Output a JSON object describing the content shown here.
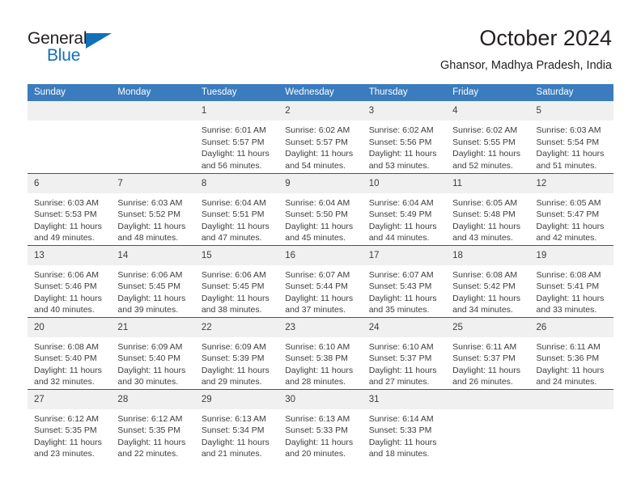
{
  "logo": {
    "word1": "General",
    "word2": "Blue",
    "triangle_icon": "triangle-icon",
    "brand_color": "#1270b8"
  },
  "header": {
    "title": "October 2024",
    "subtitle": "Ghansor, Madhya Pradesh, India"
  },
  "theme": {
    "header_bg": "#3a7cbe",
    "header_text": "#ffffff",
    "row_border": "#1f5c9e",
    "daynum_bg": "#f0f0f0",
    "text": "#3d3d3d"
  },
  "weekday_headers": [
    "Sunday",
    "Monday",
    "Tuesday",
    "Wednesday",
    "Thursday",
    "Friday",
    "Saturday"
  ],
  "weeks": [
    [
      {
        "day": "",
        "empty": true,
        "sunrise": "",
        "sunset": "",
        "daylight1": "",
        "daylight2": ""
      },
      {
        "day": "",
        "empty": true,
        "sunrise": "",
        "sunset": "",
        "daylight1": "",
        "daylight2": ""
      },
      {
        "day": "1",
        "sunrise": "Sunrise: 6:01 AM",
        "sunset": "Sunset: 5:57 PM",
        "daylight1": "Daylight: 11 hours",
        "daylight2": "and 56 minutes."
      },
      {
        "day": "2",
        "sunrise": "Sunrise: 6:02 AM",
        "sunset": "Sunset: 5:57 PM",
        "daylight1": "Daylight: 11 hours",
        "daylight2": "and 54 minutes."
      },
      {
        "day": "3",
        "sunrise": "Sunrise: 6:02 AM",
        "sunset": "Sunset: 5:56 PM",
        "daylight1": "Daylight: 11 hours",
        "daylight2": "and 53 minutes."
      },
      {
        "day": "4",
        "sunrise": "Sunrise: 6:02 AM",
        "sunset": "Sunset: 5:55 PM",
        "daylight1": "Daylight: 11 hours",
        "daylight2": "and 52 minutes."
      },
      {
        "day": "5",
        "sunrise": "Sunrise: 6:03 AM",
        "sunset": "Sunset: 5:54 PM",
        "daylight1": "Daylight: 11 hours",
        "daylight2": "and 51 minutes."
      }
    ],
    [
      {
        "day": "6",
        "sunrise": "Sunrise: 6:03 AM",
        "sunset": "Sunset: 5:53 PM",
        "daylight1": "Daylight: 11 hours",
        "daylight2": "and 49 minutes."
      },
      {
        "day": "7",
        "sunrise": "Sunrise: 6:03 AM",
        "sunset": "Sunset: 5:52 PM",
        "daylight1": "Daylight: 11 hours",
        "daylight2": "and 48 minutes."
      },
      {
        "day": "8",
        "sunrise": "Sunrise: 6:04 AM",
        "sunset": "Sunset: 5:51 PM",
        "daylight1": "Daylight: 11 hours",
        "daylight2": "and 47 minutes."
      },
      {
        "day": "9",
        "sunrise": "Sunrise: 6:04 AM",
        "sunset": "Sunset: 5:50 PM",
        "daylight1": "Daylight: 11 hours",
        "daylight2": "and 45 minutes."
      },
      {
        "day": "10",
        "sunrise": "Sunrise: 6:04 AM",
        "sunset": "Sunset: 5:49 PM",
        "daylight1": "Daylight: 11 hours",
        "daylight2": "and 44 minutes."
      },
      {
        "day": "11",
        "sunrise": "Sunrise: 6:05 AM",
        "sunset": "Sunset: 5:48 PM",
        "daylight1": "Daylight: 11 hours",
        "daylight2": "and 43 minutes."
      },
      {
        "day": "12",
        "sunrise": "Sunrise: 6:05 AM",
        "sunset": "Sunset: 5:47 PM",
        "daylight1": "Daylight: 11 hours",
        "daylight2": "and 42 minutes."
      }
    ],
    [
      {
        "day": "13",
        "sunrise": "Sunrise: 6:06 AM",
        "sunset": "Sunset: 5:46 PM",
        "daylight1": "Daylight: 11 hours",
        "daylight2": "and 40 minutes."
      },
      {
        "day": "14",
        "sunrise": "Sunrise: 6:06 AM",
        "sunset": "Sunset: 5:45 PM",
        "daylight1": "Daylight: 11 hours",
        "daylight2": "and 39 minutes."
      },
      {
        "day": "15",
        "sunrise": "Sunrise: 6:06 AM",
        "sunset": "Sunset: 5:45 PM",
        "daylight1": "Daylight: 11 hours",
        "daylight2": "and 38 minutes."
      },
      {
        "day": "16",
        "sunrise": "Sunrise: 6:07 AM",
        "sunset": "Sunset: 5:44 PM",
        "daylight1": "Daylight: 11 hours",
        "daylight2": "and 37 minutes."
      },
      {
        "day": "17",
        "sunrise": "Sunrise: 6:07 AM",
        "sunset": "Sunset: 5:43 PM",
        "daylight1": "Daylight: 11 hours",
        "daylight2": "and 35 minutes."
      },
      {
        "day": "18",
        "sunrise": "Sunrise: 6:08 AM",
        "sunset": "Sunset: 5:42 PM",
        "daylight1": "Daylight: 11 hours",
        "daylight2": "and 34 minutes."
      },
      {
        "day": "19",
        "sunrise": "Sunrise: 6:08 AM",
        "sunset": "Sunset: 5:41 PM",
        "daylight1": "Daylight: 11 hours",
        "daylight2": "and 33 minutes."
      }
    ],
    [
      {
        "day": "20",
        "sunrise": "Sunrise: 6:08 AM",
        "sunset": "Sunset: 5:40 PM",
        "daylight1": "Daylight: 11 hours",
        "daylight2": "and 32 minutes."
      },
      {
        "day": "21",
        "sunrise": "Sunrise: 6:09 AM",
        "sunset": "Sunset: 5:40 PM",
        "daylight1": "Daylight: 11 hours",
        "daylight2": "and 30 minutes."
      },
      {
        "day": "22",
        "sunrise": "Sunrise: 6:09 AM",
        "sunset": "Sunset: 5:39 PM",
        "daylight1": "Daylight: 11 hours",
        "daylight2": "and 29 minutes."
      },
      {
        "day": "23",
        "sunrise": "Sunrise: 6:10 AM",
        "sunset": "Sunset: 5:38 PM",
        "daylight1": "Daylight: 11 hours",
        "daylight2": "and 28 minutes."
      },
      {
        "day": "24",
        "sunrise": "Sunrise: 6:10 AM",
        "sunset": "Sunset: 5:37 PM",
        "daylight1": "Daylight: 11 hours",
        "daylight2": "and 27 minutes."
      },
      {
        "day": "25",
        "sunrise": "Sunrise: 6:11 AM",
        "sunset": "Sunset: 5:37 PM",
        "daylight1": "Daylight: 11 hours",
        "daylight2": "and 26 minutes."
      },
      {
        "day": "26",
        "sunrise": "Sunrise: 6:11 AM",
        "sunset": "Sunset: 5:36 PM",
        "daylight1": "Daylight: 11 hours",
        "daylight2": "and 24 minutes."
      }
    ],
    [
      {
        "day": "27",
        "sunrise": "Sunrise: 6:12 AM",
        "sunset": "Sunset: 5:35 PM",
        "daylight1": "Daylight: 11 hours",
        "daylight2": "and 23 minutes."
      },
      {
        "day": "28",
        "sunrise": "Sunrise: 6:12 AM",
        "sunset": "Sunset: 5:35 PM",
        "daylight1": "Daylight: 11 hours",
        "daylight2": "and 22 minutes."
      },
      {
        "day": "29",
        "sunrise": "Sunrise: 6:13 AM",
        "sunset": "Sunset: 5:34 PM",
        "daylight1": "Daylight: 11 hours",
        "daylight2": "and 21 minutes."
      },
      {
        "day": "30",
        "sunrise": "Sunrise: 6:13 AM",
        "sunset": "Sunset: 5:33 PM",
        "daylight1": "Daylight: 11 hours",
        "daylight2": "and 20 minutes."
      },
      {
        "day": "31",
        "sunrise": "Sunrise: 6:14 AM",
        "sunset": "Sunset: 5:33 PM",
        "daylight1": "Daylight: 11 hours",
        "daylight2": "and 18 minutes."
      },
      {
        "day": "",
        "empty": true,
        "sunrise": "",
        "sunset": "",
        "daylight1": "",
        "daylight2": ""
      },
      {
        "day": "",
        "empty": true,
        "sunrise": "",
        "sunset": "",
        "daylight1": "",
        "daylight2": ""
      }
    ]
  ]
}
